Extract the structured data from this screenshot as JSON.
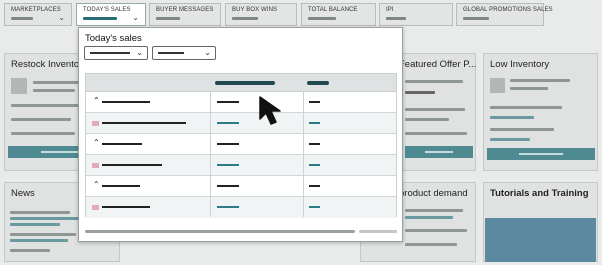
{
  "tabs": [
    {
      "label": "MARKETPLACES",
      "active": false
    },
    {
      "label": "TODAY'S SALES",
      "active": true
    },
    {
      "label": "BUYER MESSAGES",
      "active": false
    },
    {
      "label": "BUY BOX WINS",
      "active": false
    },
    {
      "label": "TOTAL BALANCE",
      "active": false
    },
    {
      "label": "IPI",
      "active": false
    },
    {
      "label": "GLOBAL PROMOTIONS SALES",
      "active": false
    }
  ],
  "cards": {
    "restock": "Restock Inventory",
    "featured": "Featured Offer P...",
    "low_inventory": "Low Inventory",
    "news": "News",
    "product_demand": "product demand",
    "tutorials": "Tutorials and Training"
  },
  "popup": {
    "title": "Today's sales"
  },
  "icons": {
    "tab_chevron": "chevron-down-icon",
    "select_chevron": "chevron-down-icon",
    "row_caret": "caret-up-icon",
    "pointer": "mouse-pointer-icon"
  },
  "colors": {
    "accent": "#2a6f77",
    "header_bar": "#1f4b50",
    "teal_text": "#2a7d85",
    "swatch": "#e3a9b9"
  }
}
